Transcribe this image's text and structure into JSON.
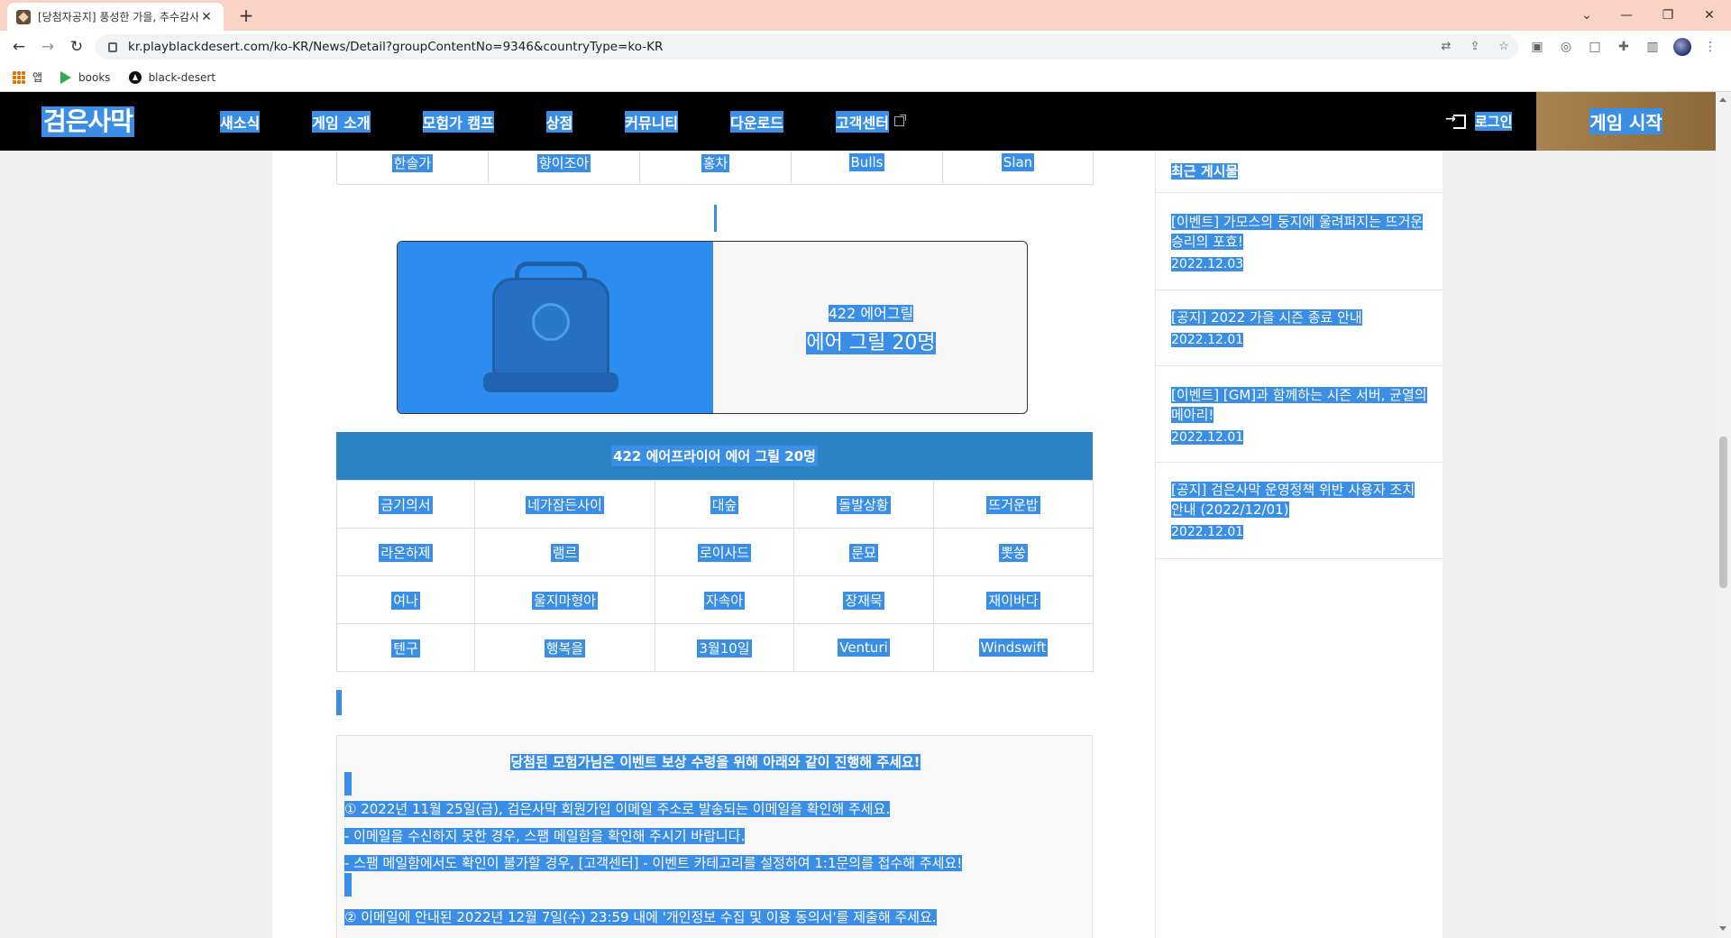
{
  "browser": {
    "tab_title": "[당첨자공지] 풍성한 가을, 추수감사",
    "tab_close": "✕",
    "new_tab": "+",
    "url": "kr.playblackdesert.com/ko-KR/News/Detail?groupContentNo=9346&countryType=ko-KR",
    "bookmarks": [
      "앱",
      "books",
      "black-desert"
    ]
  },
  "header": {
    "logo": "검은사막",
    "nav": [
      "새소식",
      "게임 소개",
      "모험가 캠프",
      "상점",
      "커뮤니티",
      "다운로드",
      "고객센터"
    ],
    "login": "로그인",
    "start": "게임 시작"
  },
  "top_table": {
    "row": [
      "한솔가",
      "향이조아",
      "홍차",
      "Bulls",
      "Slan"
    ]
  },
  "prize": {
    "small": "422 에어그릴",
    "big": "에어 그릴 20명"
  },
  "winners": {
    "header": "422 에어프라이어 에어 그릴 20명",
    "rows": [
      [
        "금기의서",
        "네가잠든사이",
        "대숲",
        "돌발상황",
        "뜨거운밥"
      ],
      [
        "라온하제",
        "램르",
        "로이사드",
        "룬묘",
        "뽓쑹"
      ],
      [
        "여나",
        "울지마형아",
        "자속아",
        "장재묵",
        "재이바다"
      ],
      [
        "텐구",
        "행복을",
        "3월10일",
        "Venturi",
        "Windswift"
      ]
    ]
  },
  "notice": {
    "title": "당첨된 모험가님은 이벤트 보상 수령을 위해 아래와 같이 진행해 주세요!",
    "lines": [
      "① 2022년 11월 25일(금), 검은사막 회원가입 이메일 주소로 발송되는 이메일을 확인해 주세요.",
      "- 이메일을 수신하지 못한 경우, 스팸 메일함을 확인해 주시기 바랍니다.",
      "- 스팸 메일함에서도 확인이 불가할 경우, [고객센터] - 이벤트 카테고리를 설정하여 1:1문의를 접수해 주세요!",
      "② 이메일에 안내된 2022년 12월 7일(수) 23:59 내에 '개인정보 수집 및 이용 동의서'를 제출해 주세요."
    ]
  },
  "sidebar": {
    "title": "최근 게시물",
    "posts": [
      {
        "title": "[이벤트] 가모스의 둥지에 울려퍼지는 뜨거운 승리의 포효!",
        "date": "2022.12.03"
      },
      {
        "title": "[공지] 2022 가을 시즌 종료 안내",
        "date": "2022.12.01"
      },
      {
        "title": "[이벤트] [GM]과 함께하는 시즌 서버, 균열의 메아리!",
        "date": "2022.12.01"
      },
      {
        "title": "[공지] 검은사막 운영정책 위반 사용자 조치 안내 (2022/12/01)",
        "date": "2022.12.01"
      }
    ]
  },
  "colors": {
    "selection": "#3a8ee6",
    "header_bg": "#000000",
    "start_gold": "#a6824f",
    "winners_header": "#2c83c3",
    "tab_strip": "#f9d4c4"
  }
}
